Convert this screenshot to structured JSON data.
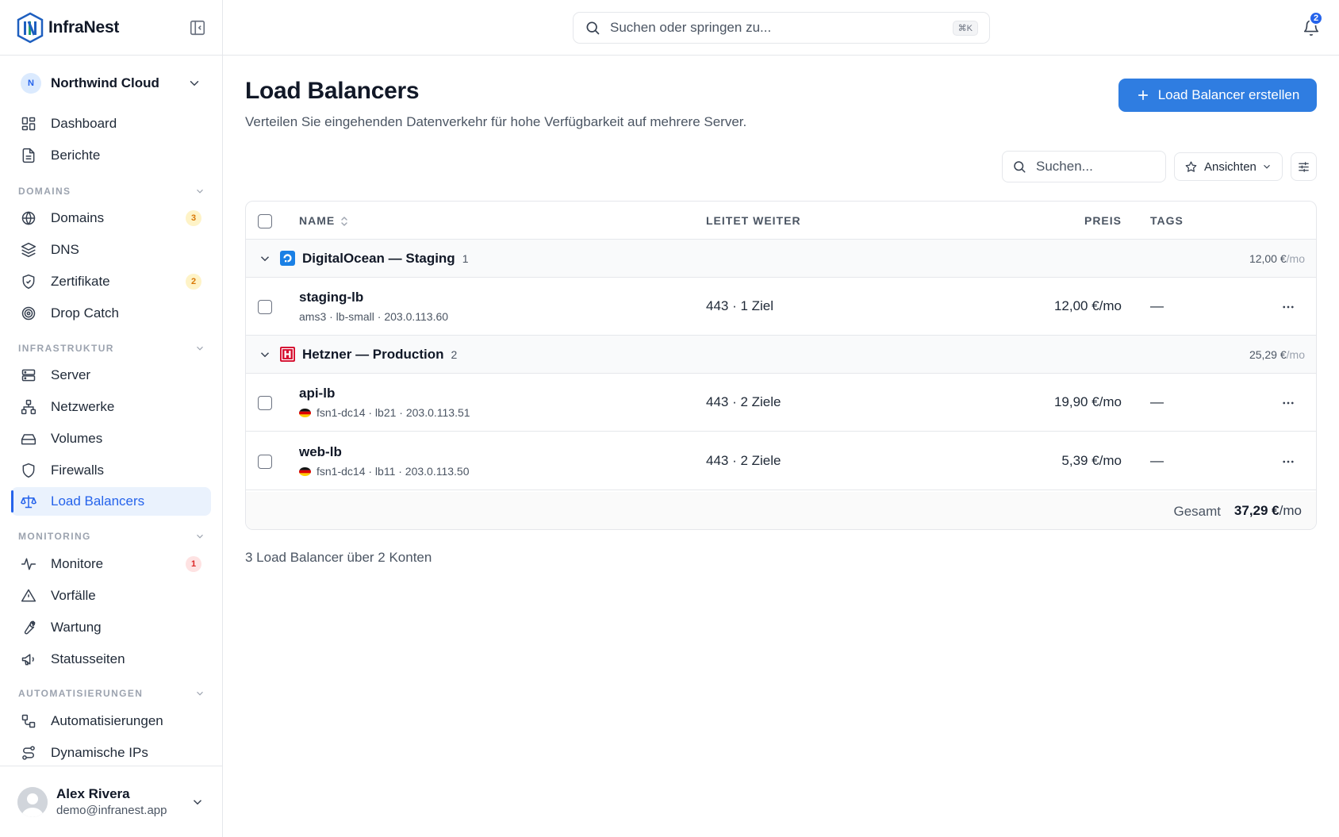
{
  "app": {
    "name": "InfraNest",
    "colors": {
      "accent": "#2563eb",
      "primary_button": "#2f7de1"
    }
  },
  "sidebar": {
    "org": {
      "initial": "N",
      "name": "Northwind Cloud"
    },
    "items": [
      {
        "label": "Dashboard",
        "icon": "dashboard-icon"
      },
      {
        "label": "Berichte",
        "icon": "file-text-icon"
      },
      {
        "label": "Domains",
        "icon": "globe-icon",
        "badge": "3"
      },
      {
        "label": "DNS",
        "icon": "layers-icon"
      },
      {
        "label": "Zertifikate",
        "icon": "shield-check-icon",
        "badge": "2"
      },
      {
        "label": "Drop Catch",
        "icon": "target-icon"
      },
      {
        "label": "Server",
        "icon": "server-icon"
      },
      {
        "label": "Netzwerke",
        "icon": "network-icon"
      },
      {
        "label": "Volumes",
        "icon": "hard-drive-icon"
      },
      {
        "label": "Firewalls",
        "icon": "shield-icon"
      },
      {
        "label": "Load Balancers",
        "icon": "scale-icon",
        "active": true
      },
      {
        "label": "Monitore",
        "icon": "activity-icon",
        "badge": "1"
      },
      {
        "label": "Vorfälle",
        "icon": "alert-triangle-icon"
      },
      {
        "label": "Wartung",
        "icon": "wrench-icon"
      },
      {
        "label": "Statusseiten",
        "icon": "megaphone-icon"
      },
      {
        "label": "Automatisierungen",
        "icon": "workflow-icon"
      },
      {
        "label": "Dynamische IPs",
        "icon": "route-icon"
      }
    ],
    "sections": [
      "DOMAINS",
      "INFRASTRUKTUR",
      "MONITORING",
      "AUTOMATISIERUNGEN"
    ],
    "user": {
      "name": "Alex Rivera",
      "email": "demo@infranest.app"
    }
  },
  "topbar": {
    "search_placeholder": "Suchen oder springen zu...",
    "shortcut": "⌘K",
    "notifications_count": "2"
  },
  "main": {
    "title": "Load Balancers",
    "subtitle": "Verteilen Sie eingehenden Datenverkehr für hohe Verfügbarkeit auf mehrere Server.",
    "create_button": "Load Balancer erstellen",
    "search_placeholder": "Suchen...",
    "views_label": "Ansichten",
    "columns": [
      "NAME",
      "LEITET WEITER",
      "PREIS",
      "TAGS"
    ],
    "groups": [
      {
        "name": "DigitalOcean — Staging",
        "count": "1",
        "total": "12,00 €",
        "unit": "/mo",
        "rows": [
          {
            "name": "staging-lb",
            "meta": "ams3 · lb-small · 203.0.113.60",
            "forwards": "443 · 1 Ziel",
            "price": "12,00 €/mo",
            "tags": "—"
          }
        ]
      },
      {
        "name": "Hetzner — Production",
        "count": "2",
        "total": "25,29 €",
        "unit": "/mo",
        "rows": [
          {
            "name": "api-lb",
            "meta": "fsn1-dc14 · lb21 · 203.0.113.51",
            "forwards": "443 · 2 Ziele",
            "price": "19,90 €/mo",
            "tags": "—"
          },
          {
            "name": "web-lb",
            "meta": "fsn1-dc14 · lb11 · 203.0.113.50",
            "forwards": "443 · 2 Ziele",
            "price": "5,39 €/mo",
            "tags": "—"
          }
        ]
      }
    ],
    "footer": {
      "label": "Gesamt",
      "value": "37,29 €",
      "unit": "/mo"
    },
    "summary": "3 Load Balancer über 2 Konten"
  }
}
